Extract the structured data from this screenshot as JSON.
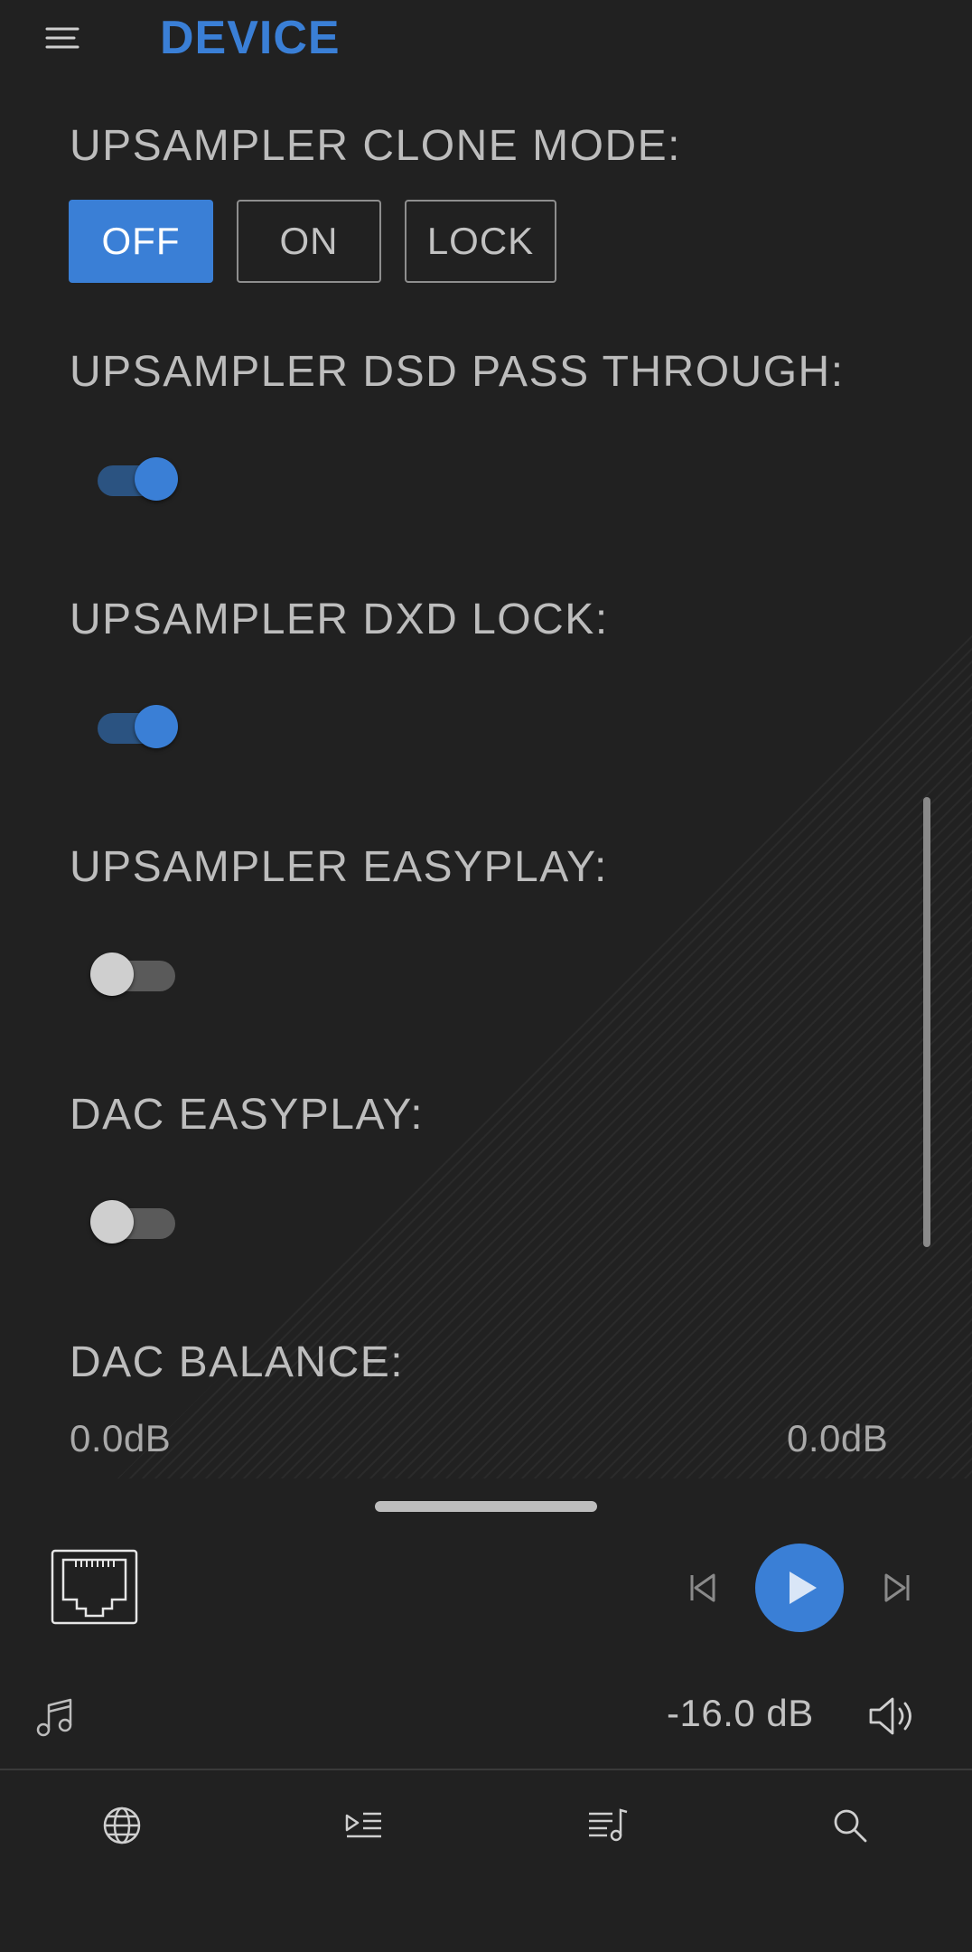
{
  "header": {
    "title": "DEVICE",
    "menu_icon": "hamburger-menu-icon"
  },
  "settings": {
    "clone_mode": {
      "label": "UPSAMPLER CLONE MODE:",
      "options": [
        "OFF",
        "ON",
        "LOCK"
      ],
      "selected": "OFF"
    },
    "dsd_pass_through": {
      "label": "UPSAMPLER DSD PASS THROUGH:",
      "enabled": true
    },
    "dxd_lock": {
      "label": "UPSAMPLER DXD LOCK:",
      "enabled": true
    },
    "upsampler_easyplay": {
      "label": "UPSAMPLER EASYPLAY:",
      "enabled": false
    },
    "dac_easyplay": {
      "label": "DAC EASYPLAY:",
      "enabled": false
    },
    "dac_balance": {
      "label": "DAC BALANCE:",
      "left": "0.0dB",
      "right": "0.0dB"
    }
  },
  "player": {
    "source_icon": "ethernet-port-icon",
    "volume": "-16.0 dB",
    "controls": [
      "previous-icon",
      "play-icon",
      "next-icon"
    ]
  },
  "bottom_nav": [
    "globe-icon",
    "queue-icon",
    "playlist-icon",
    "search-icon"
  ],
  "colors": {
    "accent": "#3a7fd6",
    "background": "#212121",
    "text": "#bdbdbd"
  }
}
